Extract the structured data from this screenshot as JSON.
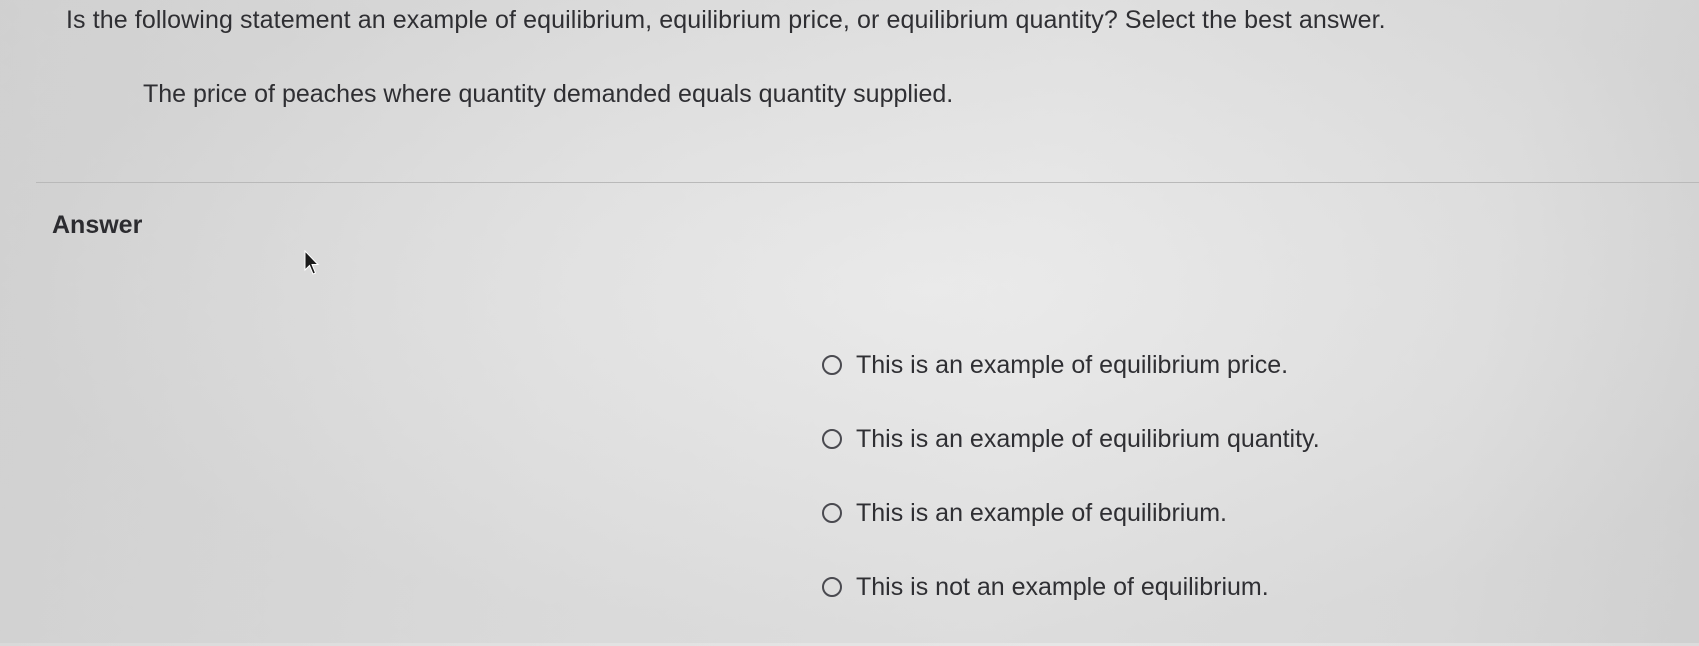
{
  "question": {
    "prompt": "Is the following statement an example of equilibrium, equilibrium price, or equilibrium quantity? Select the best answer.",
    "statement": "The price of peaches where quantity demanded equals quantity supplied."
  },
  "answer": {
    "label": "Answer",
    "options": [
      {
        "label": "This is an example of equilibrium price.",
        "selected": false
      },
      {
        "label": "This is an example of equilibrium quantity.",
        "selected": false
      },
      {
        "label": "This is an example of equilibrium.",
        "selected": false
      },
      {
        "label": "This is not an example of equilibrium.",
        "selected": false
      }
    ]
  },
  "icons": {
    "cursor": "mouse-pointer-icon",
    "radio": "radio-button-icon"
  }
}
